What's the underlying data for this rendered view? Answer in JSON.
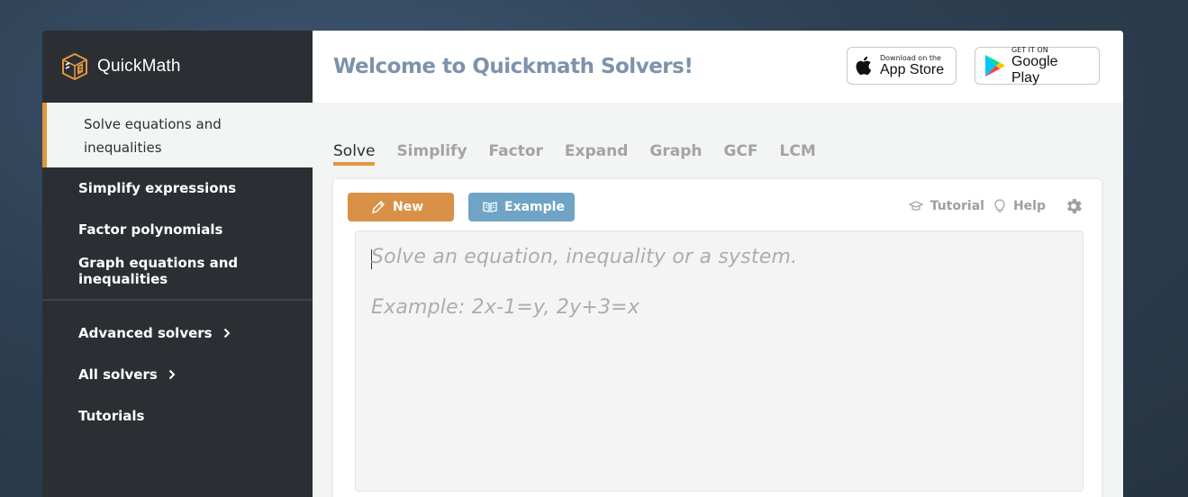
{
  "sidebar": {
    "brand": "QuickMath",
    "active_item": "Solve equations and inequalities",
    "items": [
      {
        "label": "Simplify expressions"
      },
      {
        "label": "Factor polynomials"
      },
      {
        "label": "Graph equations and inequalities"
      }
    ],
    "secondary": [
      {
        "label": "Advanced solvers"
      },
      {
        "label": "All solvers"
      },
      {
        "label": "Tutorials"
      }
    ]
  },
  "header": {
    "title": "Welcome to Quickmath Solvers!",
    "app_store": {
      "small": "Download on the",
      "big": "App Store"
    },
    "google_play": {
      "small": "GET IT ON",
      "big": "Google Play"
    }
  },
  "tabs": [
    "Solve",
    "Simplify",
    "Factor",
    "Expand",
    "Graph",
    "GCF",
    "LCM"
  ],
  "toolbar": {
    "new_label": "New",
    "example_label": "Example",
    "tutorial_label": "Tutorial",
    "help_label": "Help"
  },
  "editor": {
    "placeholder_line1": "Solve an equation, inequality or a system.",
    "placeholder_line2": "Example: 2x-1=y, 2y+3=x"
  },
  "colors": {
    "accent": "#e0963f",
    "new_button": "#d99147",
    "example_button": "#6fa4c7",
    "sidebar_bg": "#2b2f33",
    "title": "#7d93ab"
  }
}
